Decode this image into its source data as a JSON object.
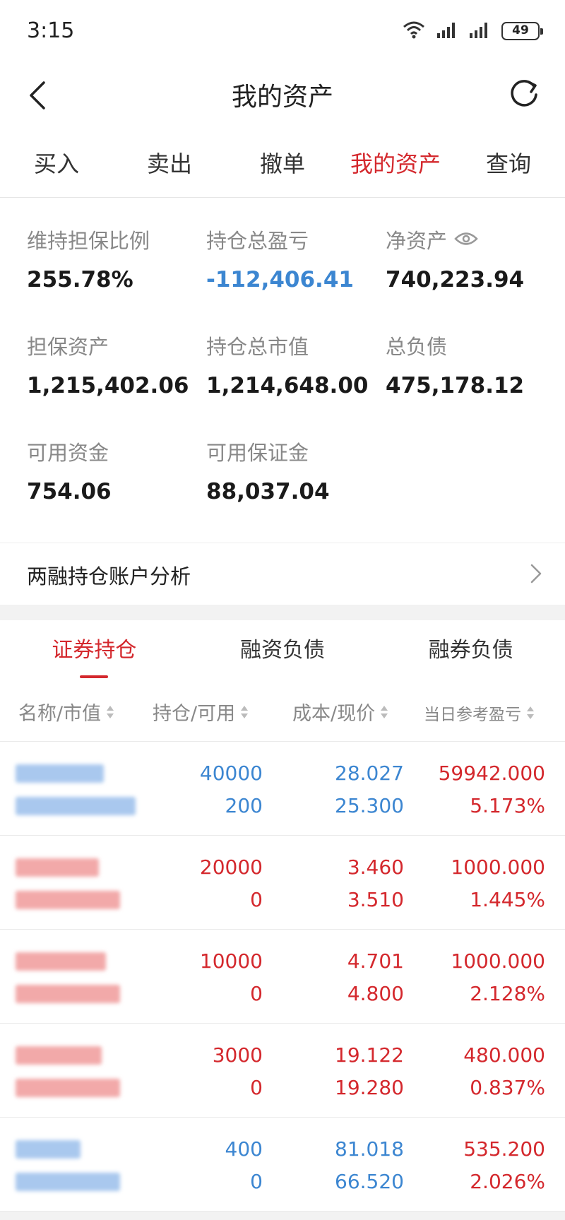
{
  "status_bar": {
    "time": "3:15",
    "battery": "49"
  },
  "nav": {
    "title": "我的资产"
  },
  "top_tabs": [
    {
      "label": "买入",
      "active": false
    },
    {
      "label": "卖出",
      "active": false
    },
    {
      "label": "撤单",
      "active": false
    },
    {
      "label": "我的资产",
      "active": true
    },
    {
      "label": "查询",
      "active": false
    }
  ],
  "summary": {
    "maintenance_ratio": {
      "label": "维持担保比例",
      "value": "255.78%"
    },
    "total_pnl": {
      "label": "持仓总盈亏",
      "value": "-112,406.41"
    },
    "net_assets": {
      "label": "净资产",
      "value": "740,223.94"
    },
    "collateral_assets": {
      "label": "担保资产",
      "value": "1,215,402.06"
    },
    "total_market_value": {
      "label": "持仓总市值",
      "value": "1,214,648.00"
    },
    "total_liabilities": {
      "label": "总负债",
      "value": "475,178.12"
    },
    "available_funds": {
      "label": "可用资金",
      "value": "754.06"
    },
    "available_margin": {
      "label": "可用保证金",
      "value": "88,037.04"
    }
  },
  "analysis": {
    "label": "两融持仓账户分析"
  },
  "sub_tabs": [
    {
      "label": "证券持仓",
      "active": true
    },
    {
      "label": "融资负债",
      "active": false
    },
    {
      "label": "融券负债",
      "active": false
    }
  ],
  "table": {
    "headers": [
      "名称/市值",
      "持仓/可用",
      "成本/现价",
      "当日参考盈亏"
    ],
    "rows": [
      {
        "hold": "40000",
        "avail": "200",
        "cost": "28.027",
        "price": "25.300",
        "pnl": "59942.000",
        "pct": "5.173%",
        "qty_color": "blue",
        "price_color": "blue",
        "pnl_color": "red",
        "name_color": "#a9c8ee"
      },
      {
        "hold": "20000",
        "avail": "0",
        "cost": "3.460",
        "price": "3.510",
        "pnl": "1000.000",
        "pct": "1.445%",
        "qty_color": "red",
        "price_color": "red",
        "pnl_color": "red",
        "name_color": "#f2a9a9"
      },
      {
        "hold": "10000",
        "avail": "0",
        "cost": "4.701",
        "price": "4.800",
        "pnl": "1000.000",
        "pct": "2.128%",
        "qty_color": "red",
        "price_color": "red",
        "pnl_color": "red",
        "name_color": "#f2a9a9"
      },
      {
        "hold": "3000",
        "avail": "0",
        "cost": "19.122",
        "price": "19.280",
        "pnl": "480.000",
        "pct": "0.837%",
        "qty_color": "red",
        "price_color": "red",
        "pnl_color": "red",
        "name_color": "#f2a9a9"
      },
      {
        "hold": "400",
        "avail": "0",
        "cost": "81.018",
        "price": "66.520",
        "pnl": "535.200",
        "pct": "2.026%",
        "qty_color": "blue",
        "price_color": "blue",
        "pnl_color": "red",
        "name_color": "#a9c8ee"
      }
    ]
  }
}
